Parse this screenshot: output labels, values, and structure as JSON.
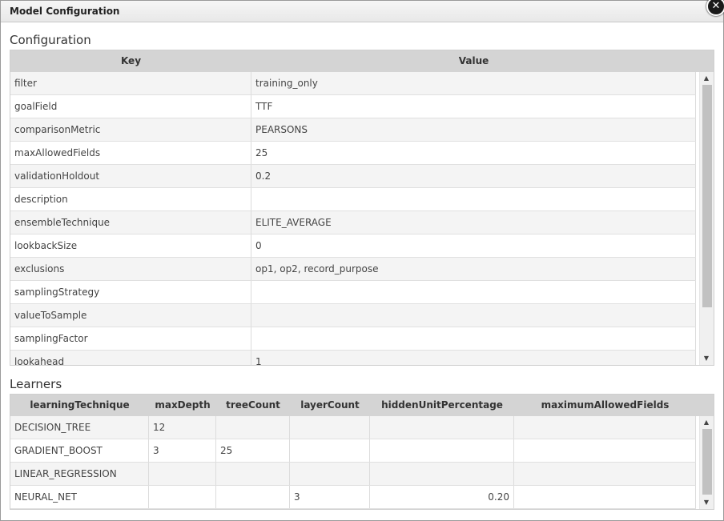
{
  "window": {
    "title": "Model Configuration"
  },
  "configuration": {
    "section_title": "Configuration",
    "columns": [
      "Key",
      "Value"
    ],
    "rows": [
      {
        "key": "filter",
        "value": "training_only"
      },
      {
        "key": "goalField",
        "value": "TTF"
      },
      {
        "key": "comparisonMetric",
        "value": "PEARSONS"
      },
      {
        "key": "maxAllowedFields",
        "value": "25"
      },
      {
        "key": "validationHoldout",
        "value": "0.2"
      },
      {
        "key": "description",
        "value": ""
      },
      {
        "key": "ensembleTechnique",
        "value": "ELITE_AVERAGE"
      },
      {
        "key": "lookbackSize",
        "value": "0"
      },
      {
        "key": "exclusions",
        "value": "op1, op2, record_purpose"
      },
      {
        "key": "samplingStrategy",
        "value": ""
      },
      {
        "key": "valueToSample",
        "value": ""
      },
      {
        "key": "samplingFactor",
        "value": ""
      },
      {
        "key": "lookahead",
        "value": "1"
      }
    ]
  },
  "learners": {
    "section_title": "Learners",
    "columns": [
      "learningTechnique",
      "maxDepth",
      "treeCount",
      "layerCount",
      "hiddenUnitPercentage",
      "maximumAllowedFields"
    ],
    "rows": [
      [
        "DECISION_TREE",
        "12",
        "",
        "",
        "",
        ""
      ],
      [
        "GRADIENT_BOOST",
        "3",
        "25",
        "",
        "",
        ""
      ],
      [
        "LINEAR_REGRESSION",
        "",
        "",
        "",
        "",
        ""
      ],
      [
        "NEURAL_NET",
        "",
        "",
        "3",
        "0.20",
        ""
      ]
    ]
  },
  "icons": {
    "close": "close-icon",
    "scroll_up": "scroll-up-arrow-icon",
    "scroll_down": "scroll-down-arrow-icon"
  },
  "colors": {
    "header_bg": "#d4d4d4",
    "alt_row": "#f4f4f4",
    "close_bg": "#1a1a1a"
  }
}
